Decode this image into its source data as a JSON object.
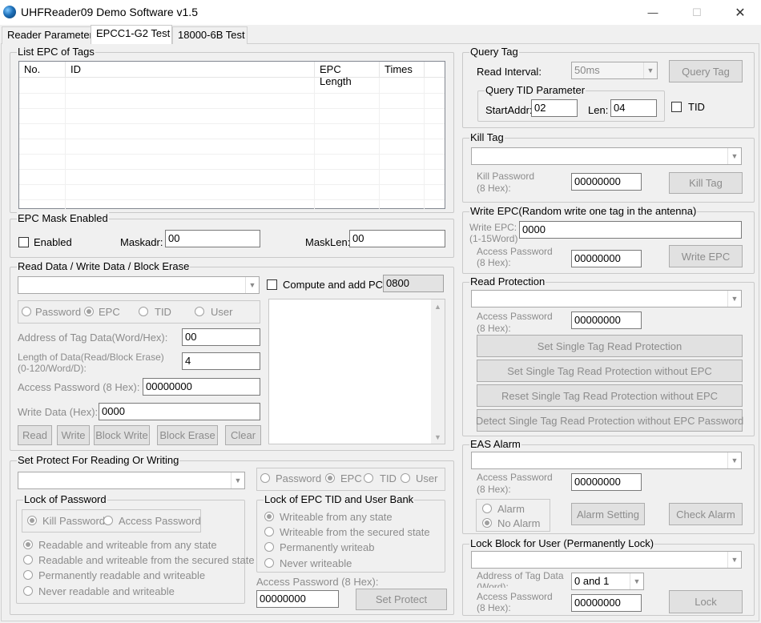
{
  "window": {
    "title": "UHFReader09 Demo Software v1.5",
    "minimize": "—",
    "maximize": "☐",
    "close": "✕"
  },
  "tabs": [
    "Reader Parameter",
    "EPCC1-G2 Test",
    "18000-6B Test"
  ],
  "list_epc": {
    "title": "List EPC of Tags",
    "columns": [
      "No.",
      "ID",
      "EPC Length",
      "Times"
    ]
  },
  "epc_mask": {
    "title": "EPC Mask Enabled",
    "enabled_label": "Enabled",
    "maskadr_label": "Maskadr:",
    "maskadr_value": "00",
    "masklen_label": "MaskLen:",
    "masklen_value": "00"
  },
  "read_write": {
    "title": "Read Data / Write Data / Block Erase",
    "compute_pc_label": "Compute and add PC:",
    "pc_value": "0800",
    "banks": [
      "Password",
      "EPC",
      "TID",
      "User"
    ],
    "address_label": "Address of Tag Data(Word/Hex):",
    "address_value": "00",
    "length_label_1": "Length of Data(Read/Block Erase)",
    "length_label_2": "(0-120/Word/D):",
    "length_value": "4",
    "access_pw_label": "Access Password (8 Hex):",
    "access_pw_value": "00000000",
    "write_data_label": "Write Data (Hex):",
    "write_data_value": "0000",
    "buttons": [
      "Read",
      "Write",
      "Block Write",
      "Block Erase",
      "Clear"
    ]
  },
  "set_protect": {
    "title": "Set Protect For Reading Or Writing",
    "banks": [
      "Password",
      "EPC",
      "TID",
      "User"
    ],
    "lock_password": {
      "title": "Lock of Password",
      "kill_password": "Kill Password",
      "access_password": "Access Password",
      "options": [
        "Readable and  writeable from any state",
        "Readable and writeable from the secured state",
        "Permanently readable and writeable",
        "Never readable and writeable"
      ]
    },
    "lock_epc": {
      "title": "Lock of EPC TID and User Bank",
      "options": [
        "Writeable from any state",
        "Writeable from the secured state",
        "Permanently writeab",
        "Never writeable"
      ]
    },
    "access_pw_label": "Access Password (8 Hex):",
    "access_pw_value": "00000000",
    "set_protect_button": "Set Protect"
  },
  "query_tag": {
    "title": "Query Tag",
    "read_interval_label": "Read Interval:",
    "read_interval_value": "50ms",
    "query_button": "Query Tag",
    "tid_param_title": "Query TID Parameter",
    "startaddr_label": "StartAddr:",
    "startaddr_value": "02",
    "len_label": "Len:",
    "len_value": "04",
    "tid_label": "TID"
  },
  "kill_tag": {
    "title": "Kill Tag",
    "pw_label_1": "Kill Password",
    "pw_label_2": "(8 Hex):",
    "pw_value": "00000000",
    "button": "Kill Tag"
  },
  "write_epc": {
    "title": "Write EPC(Random write one tag in the antenna)",
    "epc_label_1": "Write EPC:",
    "epc_label_2": "(1-15Word)",
    "epc_value": "0000",
    "pw_label_1": "Access Password",
    "pw_label_2": "(8 Hex):",
    "pw_value": "00000000",
    "button": "Write EPC"
  },
  "read_protection": {
    "title": "Read Protection",
    "pw_label_1": "Access Password",
    "pw_label_2": "(8 Hex):",
    "pw_value": "00000000",
    "buttons": [
      "Set Single Tag Read Protection",
      "Set Single Tag Read Protection without EPC",
      "Reset Single Tag Read Protection without EPC",
      "Detect Single Tag Read Protection without EPC Password"
    ]
  },
  "eas_alarm": {
    "title": "EAS Alarm",
    "pw_label_1": "Access Password",
    "pw_label_2": "(8 Hex):",
    "pw_value": "00000000",
    "alarm": "Alarm",
    "no_alarm": "No Alarm",
    "alarm_setting_button": "Alarm Setting",
    "check_alarm_button": "Check Alarm"
  },
  "lock_block": {
    "title": "Lock Block for User (Permanently Lock)",
    "addr_label_1": "Address of Tag Data",
    "addr_label_2": "(Word):",
    "addr_value": "0 and 1",
    "pw_label_1": "Access Password",
    "pw_label_2": "(8 Hex):",
    "pw_value": "00000000",
    "button": "Lock"
  }
}
